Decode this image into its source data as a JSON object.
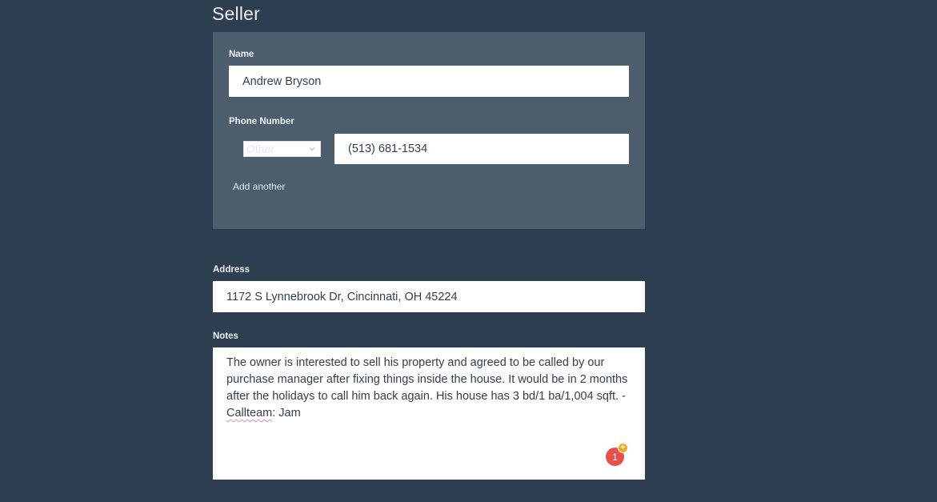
{
  "seller": {
    "title": "Seller",
    "name_label": "Name",
    "name_value": "Andrew Bryson",
    "phone_label": "Phone Number",
    "phone_type": "Other",
    "phone_value": "(513) 681-1534",
    "add_another": "Add another"
  },
  "address": {
    "label": "Address",
    "value": "1172 S Lynnebrook Dr, Cincinnati, OH 45224"
  },
  "notes": {
    "label": "Notes",
    "text_before": "The owner is interested to sell his property and agreed to be called by our purchase manager after fixing things inside the house. It would be in 2 months after the holidays to call him back again. His house has 3 bd/1 ba/1,004 sqft. - ",
    "misspelled_word": "Callteam",
    "text_after": ": Jam"
  },
  "extension_badge": {
    "count": "1",
    "plus": "+"
  },
  "colors": {
    "background": "#2d3e50",
    "panel": "#4c5d6d",
    "badge": "#e8504b",
    "badge_plus": "#f2a81d"
  }
}
